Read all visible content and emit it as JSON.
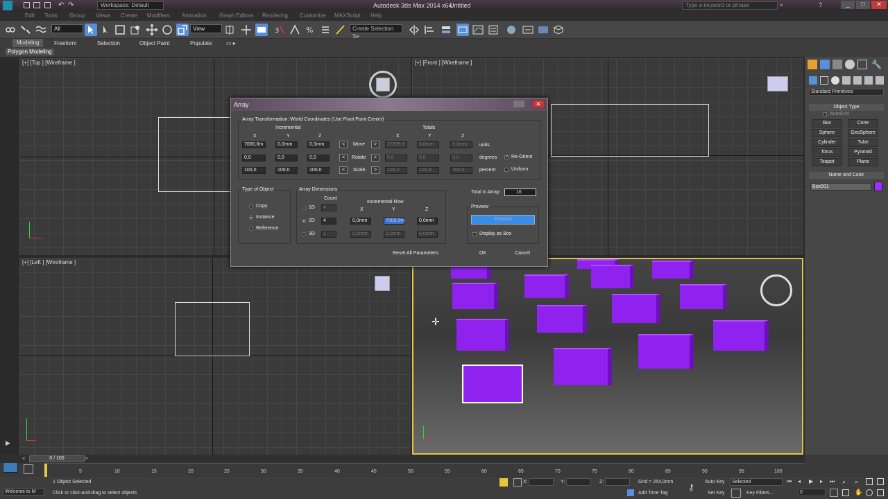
{
  "titlebar": {
    "app_title": "Autodesk 3ds Max 2014 x64",
    "doc_title": "Untitled",
    "workspace": "Workspace: Default",
    "search_placeholder": "Type a keyword or phrase"
  },
  "menus": [
    "Edit",
    "Tools",
    "Group",
    "Views",
    "Create",
    "Modifiers",
    "Animation",
    "Graph Editors",
    "Rendering",
    "Customize",
    "MAXScript",
    "Help"
  ],
  "toolbar": {
    "selection_filter": "All",
    "ref_coord": "View",
    "named_selection": "Create Selection Se"
  },
  "ribbon": {
    "tabs": [
      "Modeling",
      "Freeform",
      "Selection",
      "Object Paint",
      "Populate"
    ],
    "panel_label": "Polygon Modeling"
  },
  "viewports": {
    "top": "[+] [Top ] [Wireframe ]",
    "front": "[+] [Front ] [Wireframe ]",
    "left": "[+] [Left ] [Wireframe ]"
  },
  "cmdpanel": {
    "category": "Standard Primitives",
    "object_type_header": "Object Type",
    "autogrid": "AutoGrid",
    "buttons": [
      "Box",
      "Cone",
      "Sphere",
      "GeoSphere",
      "Cylinder",
      "Tube",
      "Torus",
      "Pyramid",
      "Teapot",
      "Plane"
    ],
    "name_color_header": "Name and Color",
    "object_name": "Box001",
    "object_color": "#9b30ff"
  },
  "dialog": {
    "title": "Array",
    "transform_group": "Array Transformation: World Coordinates (Use Pivot Point Center)",
    "incremental_label": "Incremental",
    "totals_label": "Totals",
    "axis_labels": [
      "X",
      "Y",
      "Z"
    ],
    "rows": [
      {
        "label": "Move",
        "inc": [
          "7000,0m",
          "0,0mm",
          "0,0mm"
        ],
        "tot": [
          "27999,9",
          "0,0mm",
          "0,0mm"
        ],
        "unit": "units"
      },
      {
        "label": "Rotate",
        "inc": [
          "0,0",
          "0,0",
          "0,0"
        ],
        "tot": [
          "0,0",
          "0,0",
          "0,0"
        ],
        "unit": "degrees"
      },
      {
        "label": "Scale",
        "inc": [
          "100,0",
          "100,0",
          "100,0"
        ],
        "tot": [
          "100,0",
          "100,0",
          "100,0"
        ],
        "unit": "percent"
      }
    ],
    "re_orient": "Re-Orient",
    "uniform": "Uniform",
    "type_group": "Type of Object",
    "types": [
      "Copy",
      "Instance",
      "Reference"
    ],
    "dims_group": "Array Dimensions",
    "count_label": "Count",
    "inc_row_label": "Incremental Row",
    "dims": [
      {
        "label": "1D",
        "count": "4"
      },
      {
        "label": "2D",
        "count": "4",
        "x": "0,0mm",
        "y": "7000,0m",
        "z": "0,0mm"
      },
      {
        "label": "3D",
        "count": "1",
        "x": "0,0mm",
        "y": "0,0mm",
        "z": "0,0mm"
      }
    ],
    "total_label": "Total in Array:",
    "total_value": "16",
    "preview_group": "Preview",
    "preview_btn": "Preview",
    "display_as_box": "Display as Box",
    "reset_btn": "Reset All Parameters",
    "ok_btn": "OK",
    "cancel_btn": "Cancel"
  },
  "timeline": {
    "frame": "0 / 100",
    "ticks": [
      "0",
      "5",
      "10",
      "15",
      "20",
      "25",
      "30",
      "35",
      "40",
      "45",
      "50",
      "55",
      "60",
      "65",
      "70",
      "75",
      "80",
      "85",
      "90",
      "95",
      "100"
    ]
  },
  "status": {
    "welcome": "Welcome to M",
    "selected": "1 Object Selected",
    "prompt": "Click or click-and-drag to select objects",
    "x_label": "X:",
    "y_label": "Y:",
    "z_label": "Z:",
    "grid": "Grid = 254,0mm",
    "add_time_tag": "Add Time Tag",
    "auto_key": "Auto Key",
    "set_key": "Set Key",
    "key_filters": "Key Filters...",
    "selected_dropdown": "Selected",
    "frame_field": "0"
  },
  "colors": {
    "box": "#8f22ee",
    "active_border": "#e4c34a"
  }
}
